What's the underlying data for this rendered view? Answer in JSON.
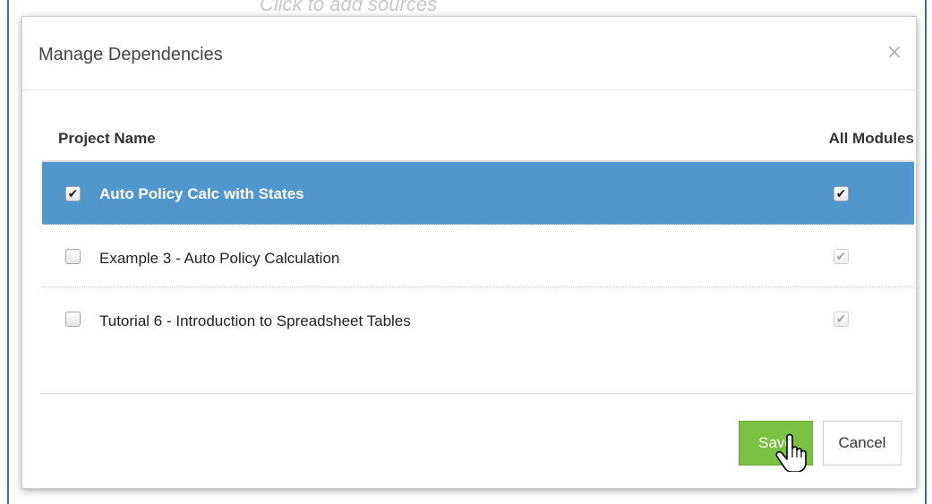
{
  "background": {
    "hint_text": "Click to add sources"
  },
  "dialog": {
    "title": "Manage Dependencies",
    "close_label": "×"
  },
  "table": {
    "headers": {
      "project_name": "Project Name",
      "all_modules": "All Modules"
    },
    "rows": [
      {
        "name": "Auto Policy Calc with States",
        "selected": true,
        "checked": true,
        "all_modules_checked": true
      },
      {
        "name": "Example 3 - Auto Policy Calculation",
        "selected": false,
        "checked": false,
        "all_modules_checked": true
      },
      {
        "name": "Tutorial 6 - Introduction to Spreadsheet Tables",
        "selected": false,
        "checked": false,
        "all_modules_checked": true
      }
    ]
  },
  "footer": {
    "save_label": "Save",
    "cancel_label": "Cancel"
  },
  "colors": {
    "selected_row": "#4f97cd",
    "save_button": "#7ac142",
    "page_border": "#3c6ea6"
  }
}
